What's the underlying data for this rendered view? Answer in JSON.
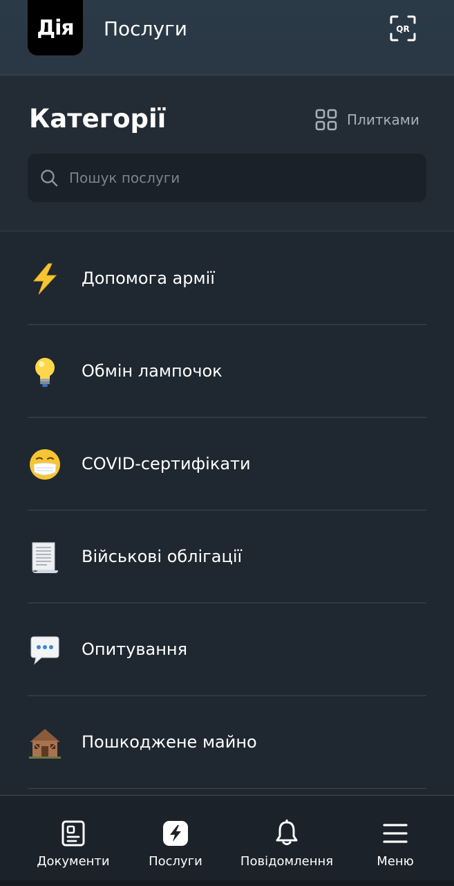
{
  "header": {
    "logo_text": "Дія",
    "title": "Послуги",
    "qr_icon": "qr-scan-icon",
    "qr_text": "QR"
  },
  "categories": {
    "title": "Категорії",
    "view_toggle_label": "Плитками",
    "view_toggle_icon": "grid-icon",
    "search_placeholder": "Пошук послуги"
  },
  "items": [
    {
      "label": "Допомога армії",
      "icon": "lightning-emoji"
    },
    {
      "label": "Обмін лампочок",
      "icon": "light-bulb-emoji"
    },
    {
      "label": "COVID-сертифікати",
      "icon": "face-mask-emoji"
    },
    {
      "label": "Військові облігації",
      "icon": "receipt-scroll-emoji"
    },
    {
      "label": "Опитування",
      "icon": "speech-bubble-emoji"
    },
    {
      "label": "Пошкоджене майно",
      "icon": "derelict-house-emoji"
    }
  ],
  "nav": [
    {
      "label": "Документи",
      "icon": "document-icon",
      "active": false
    },
    {
      "label": "Послуги",
      "icon": "lightning-icon",
      "active": true
    },
    {
      "label": "Повідомлення",
      "icon": "bell-icon",
      "active": false
    },
    {
      "label": "Меню",
      "icon": "menu-icon",
      "active": false
    }
  ],
  "colors": {
    "background": "#1f2730",
    "header": "#2b3a47",
    "search_bg": "#1a2128",
    "muted_text": "#a7b1bc",
    "divider": "#2e3944"
  }
}
